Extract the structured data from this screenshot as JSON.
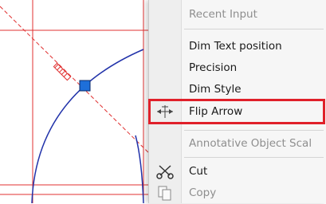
{
  "menu": {
    "items": [
      {
        "label": "Recent Input",
        "enabled": false
      },
      {
        "label": "Dim Text position",
        "enabled": true
      },
      {
        "label": "Precision",
        "enabled": true
      },
      {
        "label": "Dim Style",
        "enabled": true
      },
      {
        "label": "Flip Arrow",
        "enabled": true,
        "highlighted": true,
        "icon": "flip-arrow-icon"
      },
      {
        "label": "Annotative Object Scal",
        "enabled": false
      },
      {
        "label": "Cut",
        "enabled": true,
        "icon": "scissors-icon"
      },
      {
        "label": "Copy",
        "enabled": false,
        "icon": "copy-icon"
      }
    ]
  },
  "colors": {
    "construction_line": "#e03030",
    "arc": "#2233aa",
    "grip": "#1e6fd9",
    "highlight_border": "#e0202a"
  }
}
